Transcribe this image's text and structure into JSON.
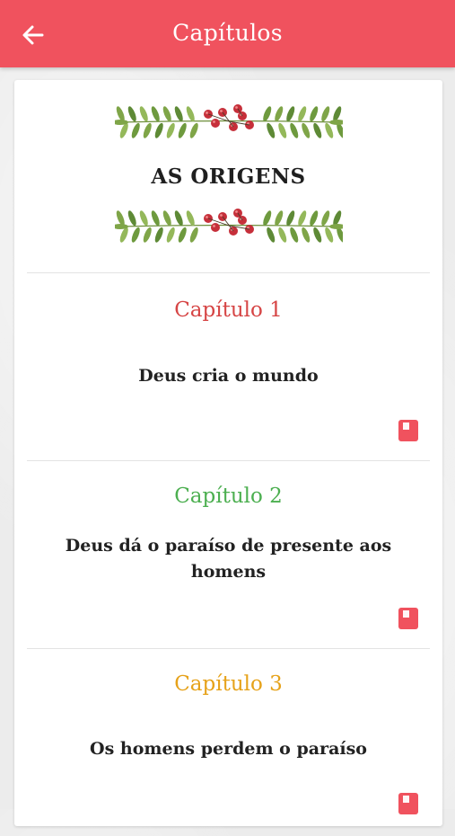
{
  "appbar": {
    "title": "Capítulos",
    "color": "#f0525e"
  },
  "header": {
    "title": "AS ORIGENS"
  },
  "chapters": [
    {
      "label": "Capítulo 1",
      "text": "Deus cria o mundo",
      "color": "#d64545"
    },
    {
      "label": "Capítulo 2",
      "text": "Deus dá o paraíso de presente aos homens",
      "color": "#4caf50"
    },
    {
      "label": "Capítulo 3",
      "text": "Os homens perdem o paraíso",
      "color": "#e6a21a"
    }
  ],
  "icons": {
    "back": "arrow-left-icon",
    "read": "book-icon",
    "ornament": "floral-garland-icon"
  },
  "colors": {
    "book_icon": "#f0525e",
    "leaf": "#7fa548",
    "berry": "#c62f3a"
  }
}
